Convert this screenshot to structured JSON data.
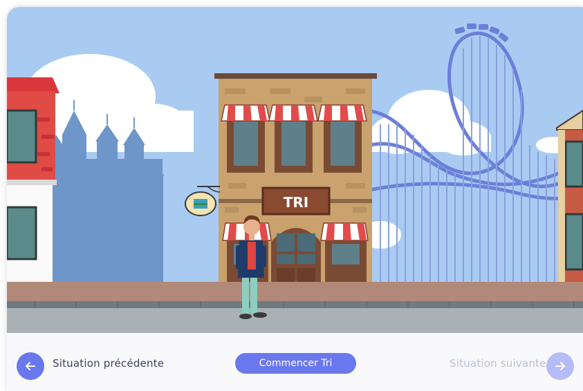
{
  "scene": {
    "shop_sign": "TRI"
  },
  "footer": {
    "prev_label": "Situation précédente",
    "next_label": "Situation suivante",
    "start_label": "Commencer Tri",
    "prev_icon": "arrow-left-icon",
    "next_icon": "arrow-right-icon"
  },
  "colors": {
    "accent": "#6a78ee",
    "accent_disabled": "#b5bcf7",
    "sky": "#a9cbf2"
  }
}
